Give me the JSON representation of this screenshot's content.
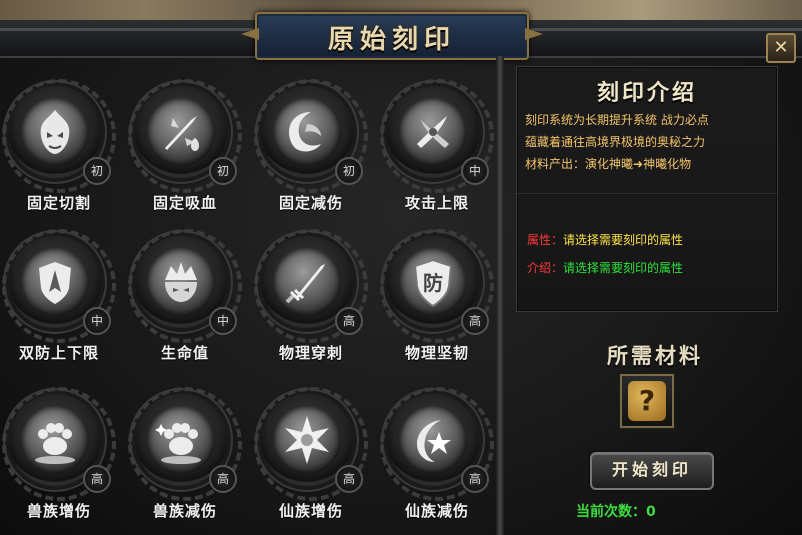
{
  "window": {
    "title": "原始刻印",
    "close_label": "✕"
  },
  "engravings": [
    {
      "name": "固定切割",
      "grade": "初",
      "icon": "flame-demon-icon"
    },
    {
      "name": "固定吸血",
      "grade": "初",
      "icon": "blade-blood-icon"
    },
    {
      "name": "固定减伤",
      "grade": "初",
      "icon": "shield-swirl-icon"
    },
    {
      "name": "攻击上限",
      "grade": "中",
      "icon": "crossed-blades-icon"
    },
    {
      "name": "双防上下限",
      "grade": "中",
      "icon": "emblem-shield-icon"
    },
    {
      "name": "生命值",
      "grade": "中",
      "icon": "crown-helmet-icon"
    },
    {
      "name": "物理穿刺",
      "grade": "高",
      "icon": "sword-pierce-icon"
    },
    {
      "name": "物理坚韧",
      "grade": "高",
      "icon": "defense-shield-icon"
    },
    {
      "name": "兽族增伤",
      "grade": "高",
      "icon": "paw-icon"
    },
    {
      "name": "兽族减伤",
      "grade": "高",
      "icon": "paw-sparkle-icon"
    },
    {
      "name": "仙族增伤",
      "grade": "高",
      "icon": "crystal-star-icon"
    },
    {
      "name": "仙族减伤",
      "grade": "高",
      "icon": "moon-star-icon"
    }
  ],
  "shield_glyph": "防",
  "intro": {
    "title": "刻印介绍",
    "line1": "刻印系统为长期提升系统 战力必点",
    "line2": "蕴藏着通往高境界极境的奥秘之力",
    "line3_prefix": "材料产出：演化神曦",
    "line3_arrow": "➜",
    "line3_suffix": "神曦化物",
    "attr_key": "属性：",
    "attr_value": "请选择需要刻印的属性",
    "intro_key": "介绍：",
    "intro_value": "请选择需要刻印的属性"
  },
  "materials": {
    "title": "所需材料",
    "slot_icon": "question-mark-icon",
    "slot_glyph": "?"
  },
  "start_label": "开始刻印",
  "count": {
    "label": "当前次数：",
    "value": "0"
  },
  "colors": {
    "accent_gold": "#f3c46b",
    "key_red": "#ff3a3a",
    "value_yellow": "#ffe34a",
    "value_green": "#2fe23a",
    "count_green": "#3fdc3f"
  }
}
